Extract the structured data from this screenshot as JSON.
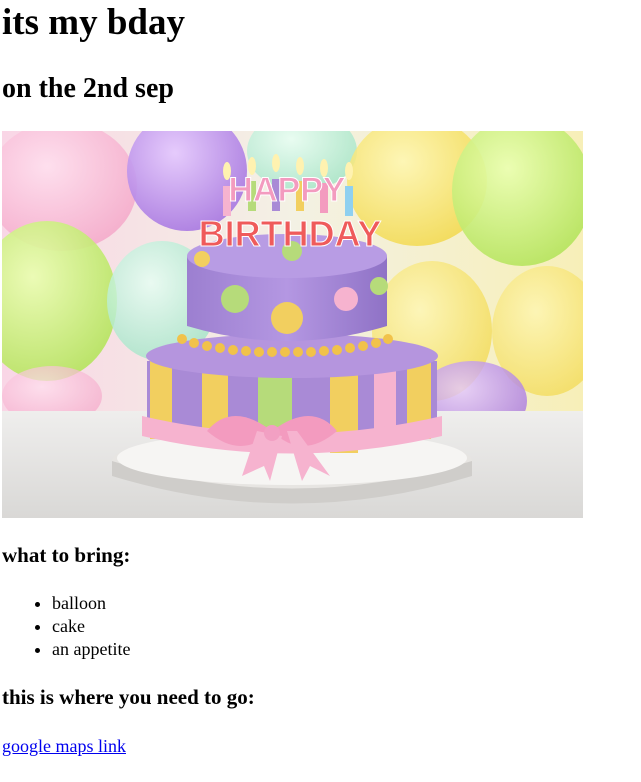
{
  "header": {
    "title": "its my bday",
    "subtitle": "on the 2nd sep"
  },
  "hero_image": {
    "cake_text_line1": "HAPPY",
    "cake_text_line2": "BIRTHDAY"
  },
  "bring_section": {
    "heading": "what to bring:",
    "items": [
      "balloon",
      "cake",
      "an appetite"
    ]
  },
  "location_section": {
    "heading": "this is where you need to go:",
    "link_text": "google maps link"
  },
  "colors": {
    "link": "#0000ee",
    "cake_purple": "#a98ad6",
    "ribbon_pink": "#f6b3cf",
    "stripe_yellow": "#f2cf5f",
    "stripe_green": "#b6db7a"
  }
}
